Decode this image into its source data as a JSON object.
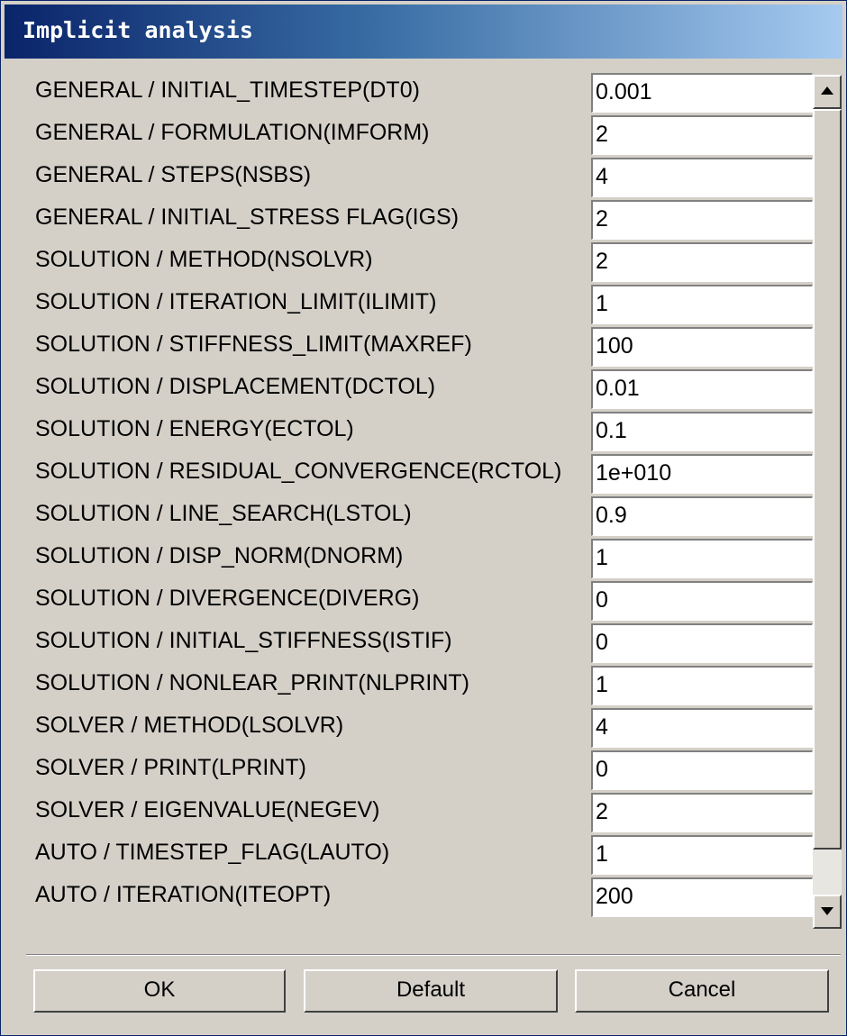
{
  "window": {
    "title": "Implicit analysis"
  },
  "fields": [
    {
      "label": "GENERAL / INITIAL_TIMESTEP(DT0)",
      "value": "0.001"
    },
    {
      "label": "GENERAL / FORMULATION(IMFORM)",
      "value": "2"
    },
    {
      "label": "GENERAL / STEPS(NSBS)",
      "value": "4"
    },
    {
      "label": "GENERAL / INITIAL_STRESS FLAG(IGS)",
      "value": "2"
    },
    {
      "label": "SOLUTION / METHOD(NSOLVR)",
      "value": "2"
    },
    {
      "label": "SOLUTION / ITERATION_LIMIT(ILIMIT)",
      "value": "1"
    },
    {
      "label": "SOLUTION / STIFFNESS_LIMIT(MAXREF)",
      "value": "100"
    },
    {
      "label": "SOLUTION / DISPLACEMENT(DCTOL)",
      "value": "0.01"
    },
    {
      "label": "SOLUTION / ENERGY(ECTOL)",
      "value": "0.1"
    },
    {
      "label": "SOLUTION / RESIDUAL_CONVERGENCE(RCTOL)",
      "value": "1e+010"
    },
    {
      "label": "SOLUTION / LINE_SEARCH(LSTOL)",
      "value": "0.9"
    },
    {
      "label": "SOLUTION / DISP_NORM(DNORM)",
      "value": "1"
    },
    {
      "label": "SOLUTION / DIVERGENCE(DIVERG)",
      "value": "0"
    },
    {
      "label": "SOLUTION / INITIAL_STIFFNESS(ISTIF)",
      "value": "0"
    },
    {
      "label": "SOLUTION / NONLEAR_PRINT(NLPRINT)",
      "value": "1"
    },
    {
      "label": "SOLVER / METHOD(LSOLVR)",
      "value": "4"
    },
    {
      "label": "SOLVER / PRINT(LPRINT)",
      "value": "0"
    },
    {
      "label": "SOLVER / EIGENVALUE(NEGEV)",
      "value": "2"
    },
    {
      "label": "AUTO / TIMESTEP_FLAG(LAUTO)",
      "value": "1"
    },
    {
      "label": "AUTO / ITERATION(ITEOPT)",
      "value": "200"
    }
  ],
  "buttons": {
    "ok": "OK",
    "default": "Default",
    "cancel": "Cancel"
  },
  "scrollbar": {
    "up_icon": "scroll-up-arrow-icon",
    "down_icon": "scroll-down-arrow-icon"
  },
  "colors": {
    "dialog_bg": "#d4d0c8",
    "title_start": "#0a246a",
    "title_end": "#a6caf0"
  }
}
